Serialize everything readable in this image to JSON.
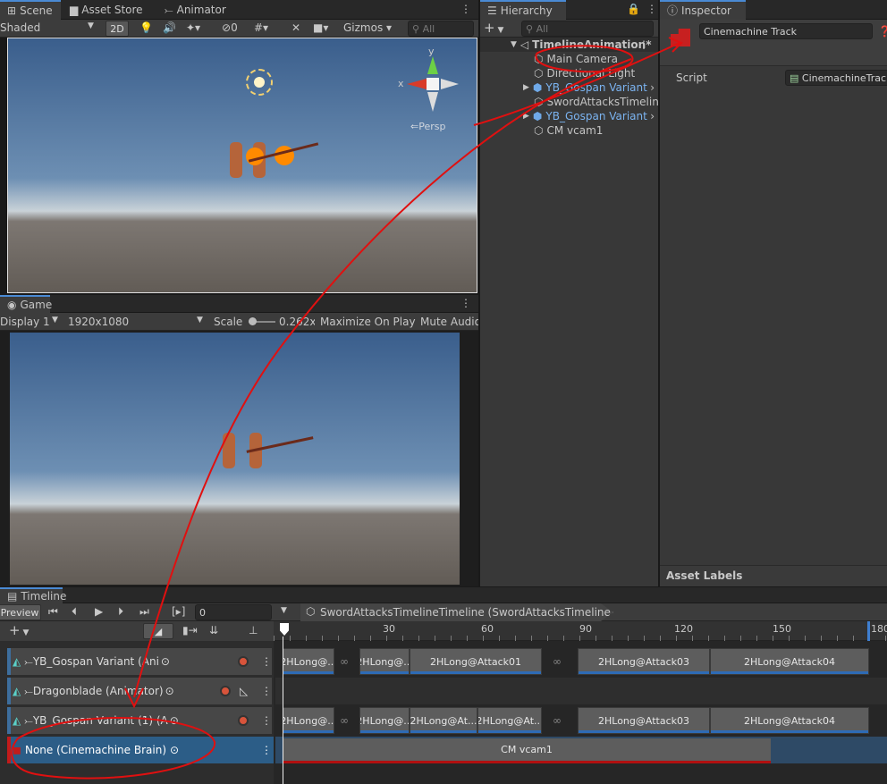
{
  "scene": {
    "tabs": [
      "Scene",
      "Asset Store",
      "Animator"
    ],
    "shading_mode": "Shaded",
    "btn_2d": "2D",
    "hidden_count": "0",
    "gizmos": "Gizmos",
    "search_placeholder": "All",
    "axis_x": "x",
    "axis_y": "y",
    "projection": "Persp"
  },
  "game": {
    "tab": "Game",
    "display": "Display 1",
    "resolution": "1920x1080",
    "scale_label": "Scale",
    "scale_value": "0.262x",
    "maximize": "Maximize On Play",
    "mute": "Mute Audio"
  },
  "hierarchy": {
    "tab": "Hierarchy",
    "search_placeholder": "All",
    "items": [
      {
        "label": "TimelineAnimation*",
        "kind": "scene"
      },
      {
        "label": "Main Camera",
        "kind": "object"
      },
      {
        "label": "Directional Light",
        "kind": "object"
      },
      {
        "label": "YB_Gospan Variant",
        "kind": "prefab"
      },
      {
        "label": "SwordAttacksTimeline",
        "kind": "object"
      },
      {
        "label": "YB_Gospan Variant",
        "kind": "prefab"
      },
      {
        "label": "CM vcam1",
        "kind": "object"
      }
    ]
  },
  "inspector": {
    "tab": "Inspector",
    "object_name": "Cinemachine Track",
    "script_label": "Script",
    "script_value": "CinemachineTrack",
    "asset_labels": "Asset Labels"
  },
  "timeline": {
    "tab": "Timeline",
    "preview": "Preview",
    "frame": "0",
    "asset": "SwordAttacksTimelineTimeline (SwordAttacksTimeline)",
    "ruler": [
      "30",
      "60",
      "90",
      "120",
      "150",
      "180"
    ],
    "tracks": [
      {
        "label": "YB_Gospan Variant (Ani",
        "clips": [
          "2HLong@...",
          "2HLong@...",
          "2HLong@Attack01",
          "2HLong@Attack03",
          "2HLong@Attack04"
        ]
      },
      {
        "label": "Dragonblade (Animator)",
        "clips": []
      },
      {
        "label": "YB_Gospan Variant (1) (A",
        "clips": [
          "2HLong@...",
          "2HLong@...",
          "2HLong@At...",
          "2HLong@At...",
          "2HLong@Attack03",
          "2HLong@Attack04"
        ]
      },
      {
        "label": "None (Cinemachine Brain)",
        "clips": [
          "CM vcam1"
        ]
      }
    ]
  },
  "colors": {
    "accent": "#4a8ad4",
    "selection": "#2c5d87",
    "annotation": "#e01010",
    "record": "#d8543b"
  }
}
